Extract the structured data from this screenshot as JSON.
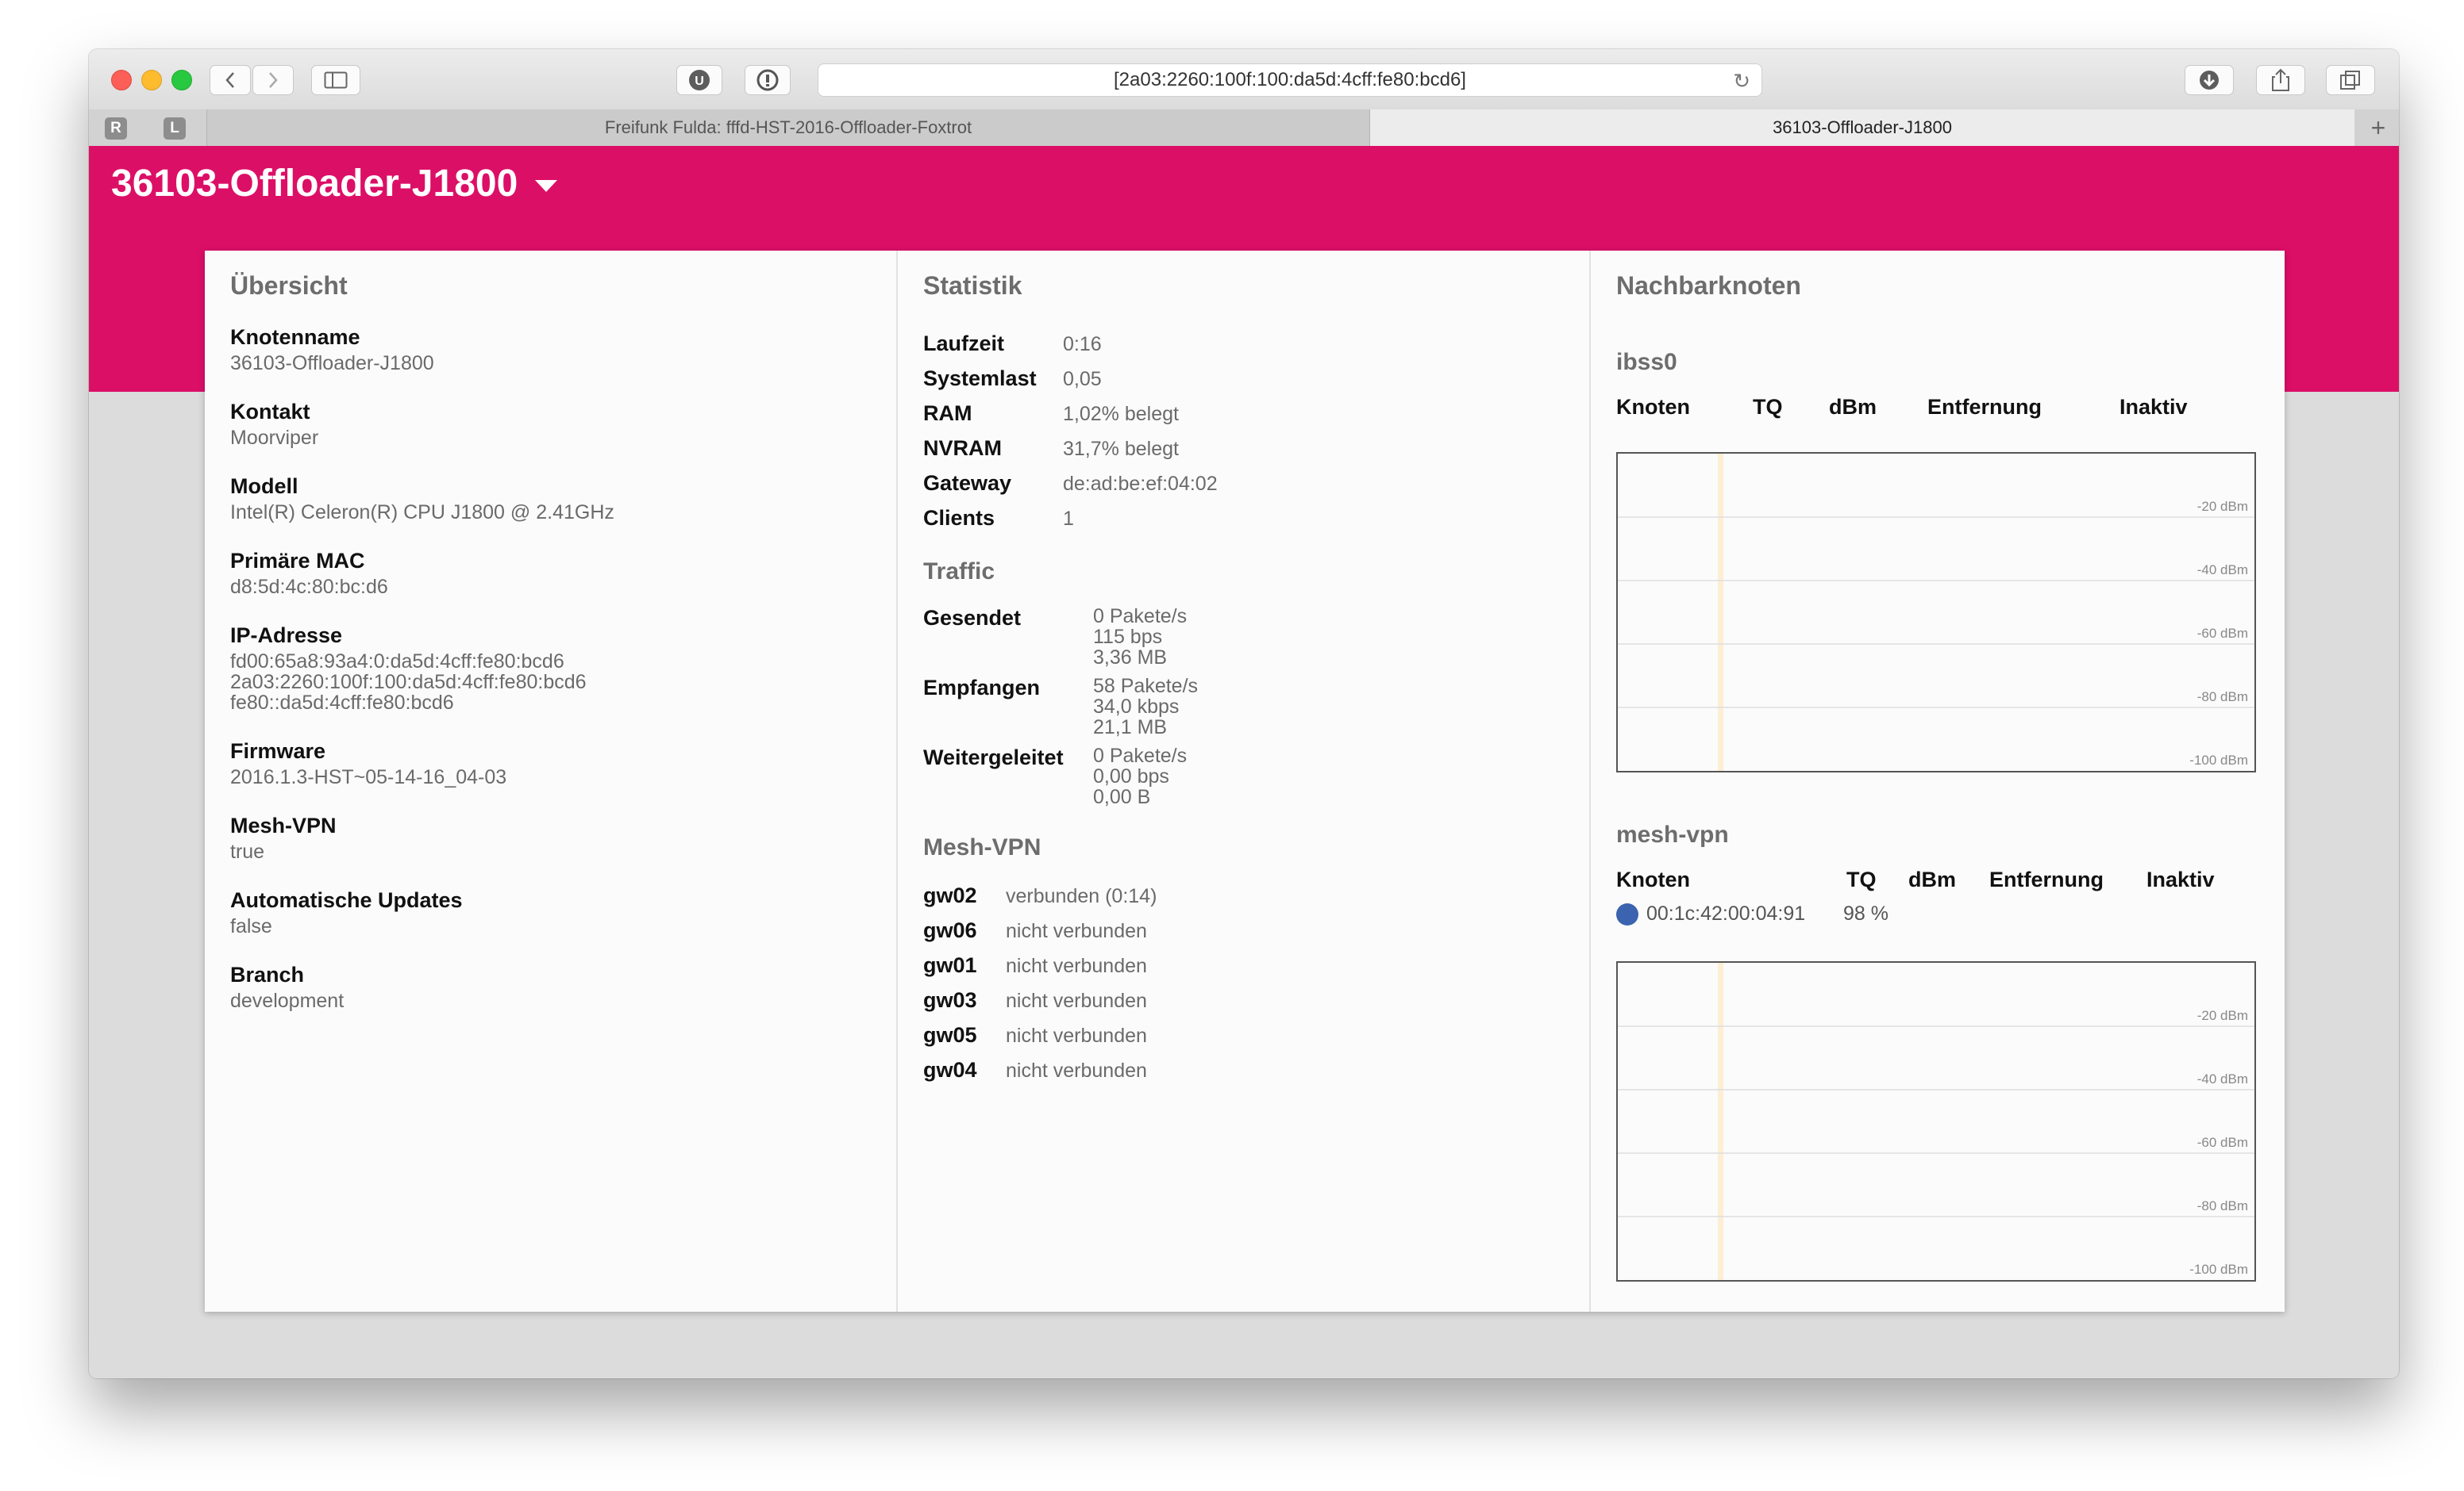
{
  "browser": {
    "url": "[2a03:2260:100f:100:da5d:4cff:fe80:bcd6]",
    "pinned_tabs": [
      "R",
      "L"
    ],
    "tabs": [
      {
        "label": "Freifunk Fulda: fffd-HST-2016-Offloader-Foxtrot",
        "active": false
      },
      {
        "label": "36103-Offloader-J1800",
        "active": true
      }
    ],
    "icons": [
      "back-icon",
      "forward-icon",
      "sidebar-icon",
      "ublock-icon",
      "privacy-icon",
      "reload-icon",
      "download-icon",
      "share-icon",
      "tabs-icon",
      "new-tab-icon"
    ]
  },
  "header": {
    "node": "36103-Offloader-J1800",
    "accent_color": "#dc0f67"
  },
  "overview": {
    "title": "Übersicht",
    "items": [
      {
        "label": "Knotenname",
        "value": "36103-Offloader-J1800"
      },
      {
        "label": "Kontakt",
        "value": "Moorviper"
      },
      {
        "label": "Modell",
        "value": "Intel(R) Celeron(R) CPU J1800 @ 2.41GHz"
      },
      {
        "label": "Primäre MAC",
        "value": "d8:5d:4c:80:bc:d6"
      },
      {
        "label": "IP-Adresse",
        "values": [
          "fd00:65a8:93a4:0:da5d:4cff:fe80:bcd6",
          "2a03:2260:100f:100:da5d:4cff:fe80:bcd6",
          "fe80::da5d:4cff:fe80:bcd6"
        ]
      },
      {
        "label": "Firmware",
        "value": "2016.1.3-HST~05-14-16_04-03"
      },
      {
        "label": "Mesh-VPN",
        "value": "true"
      },
      {
        "label": "Automatische Updates",
        "value": "false"
      },
      {
        "label": "Branch",
        "value": "development"
      }
    ]
  },
  "stats": {
    "title": "Statistik",
    "rows": [
      {
        "label": "Laufzeit",
        "value": "0:16"
      },
      {
        "label": "Systemlast",
        "value": "0,05"
      },
      {
        "label": "RAM",
        "value": "1,02% belegt"
      },
      {
        "label": "NVRAM",
        "value": "31,7% belegt"
      },
      {
        "label": "Gateway",
        "value": "de:ad:be:ef:04:02"
      },
      {
        "label": "Clients",
        "value": "1"
      }
    ],
    "traffic_title": "Traffic",
    "traffic": [
      {
        "label": "Gesendet",
        "lines": [
          "0 Pakete/s",
          "115 bps",
          "3,36 MB"
        ]
      },
      {
        "label": "Empfangen",
        "lines": [
          "58 Pakete/s",
          "34,0 kbps",
          "21,1 MB"
        ]
      },
      {
        "label": "Weitergeleitet",
        "lines": [
          "0 Pakete/s",
          "0,00 bps",
          "0,00 B"
        ]
      }
    ],
    "vpn_title": "Mesh-VPN",
    "vpn": [
      {
        "label": "gw02",
        "value": "verbunden (0:14)"
      },
      {
        "label": "gw06",
        "value": "nicht verbunden"
      },
      {
        "label": "gw01",
        "value": "nicht verbunden"
      },
      {
        "label": "gw03",
        "value": "nicht verbunden"
      },
      {
        "label": "gw05",
        "value": "nicht verbunden"
      },
      {
        "label": "gw04",
        "value": "nicht verbunden"
      }
    ]
  },
  "neighbours": {
    "title": "Nachbarknoten",
    "columns": [
      "Knoten",
      "TQ",
      "dBm",
      "Entfernung",
      "Inaktiv"
    ],
    "graph_labels": [
      "-20 dBm",
      "-40 dBm",
      "-60 dBm",
      "-80 dBm",
      "-100 dBm"
    ],
    "interfaces": [
      {
        "name": "ibss0",
        "rows": []
      },
      {
        "name": "mesh-vpn",
        "rows": [
          {
            "node": "00:1c:42:00:04:91",
            "tq": "98 %",
            "dot_color": "#3b63b0"
          }
        ]
      }
    ]
  }
}
